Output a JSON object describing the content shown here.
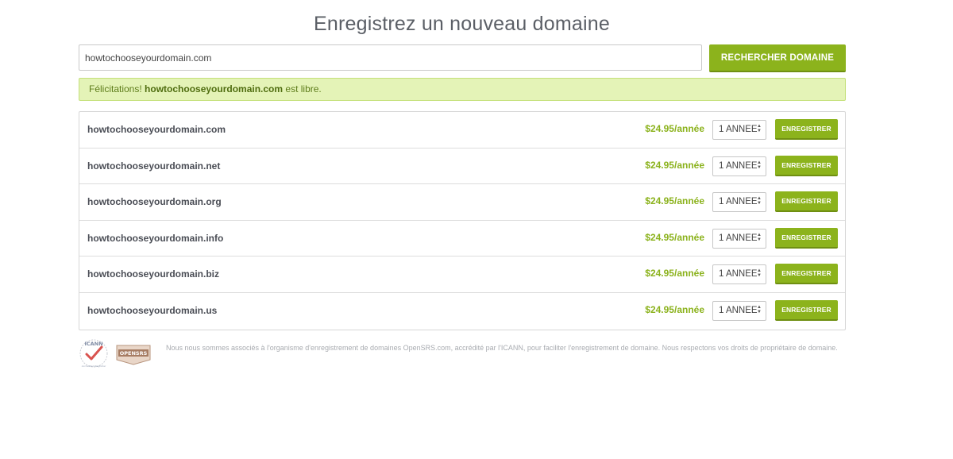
{
  "page": {
    "title": "Enregistrez un nouveau domaine"
  },
  "search": {
    "value": "howtochooseyourdomain.com",
    "button_label": "RECHERCHER DOMAINE"
  },
  "banner": {
    "prefix": "Félicitations!",
    "domain": "howtochooseyourdomain.com",
    "suffix": "est libre."
  },
  "results": [
    {
      "domain": "howtochooseyourdomain.com",
      "price": "$24.95/année",
      "term": "1 ANNEE",
      "button_label": "ENREGISTRER"
    },
    {
      "domain": "howtochooseyourdomain.net",
      "price": "$24.95/année",
      "term": "1 ANNEE",
      "button_label": "ENREGISTRER"
    },
    {
      "domain": "howtochooseyourdomain.org",
      "price": "$24.95/année",
      "term": "1 ANNEE",
      "button_label": "ENREGISTRER"
    },
    {
      "domain": "howtochooseyourdomain.info",
      "price": "$24.95/année",
      "term": "1 ANNEE",
      "button_label": "ENREGISTRER"
    },
    {
      "domain": "howtochooseyourdomain.biz",
      "price": "$24.95/année",
      "term": "1 ANNEE",
      "button_label": "ENREGISTRER"
    },
    {
      "domain": "howtochooseyourdomain.us",
      "price": "$24.95/année",
      "term": "1 ANNEE",
      "button_label": "ENREGISTRER"
    }
  ],
  "footer": {
    "icann_logo_text": "ICANN",
    "icann_logo_subtext": "Accredited Registrar",
    "opensrs_logo_text": "OPENSRS",
    "text": "Nous nous sommes associés à l'organisme d'enregistrement de domaines OpenSRS.com, accrédité par l'ICANN, pour faciliter l'enregistrement de domaine. Nous respectons vos droits de propriétaire de domaine."
  },
  "colors": {
    "accent_green": "#8cb31c",
    "banner_bg": "#e4f3b7",
    "banner_border": "#c4e079",
    "price_green": "#8bb21c",
    "title_gray": "#5b5f66"
  },
  "icons": {
    "select_arrows": "up-down-chevron-icon",
    "icann_logo": "icann-checkmark-seal",
    "opensrs_logo": "opensrs-badge"
  }
}
